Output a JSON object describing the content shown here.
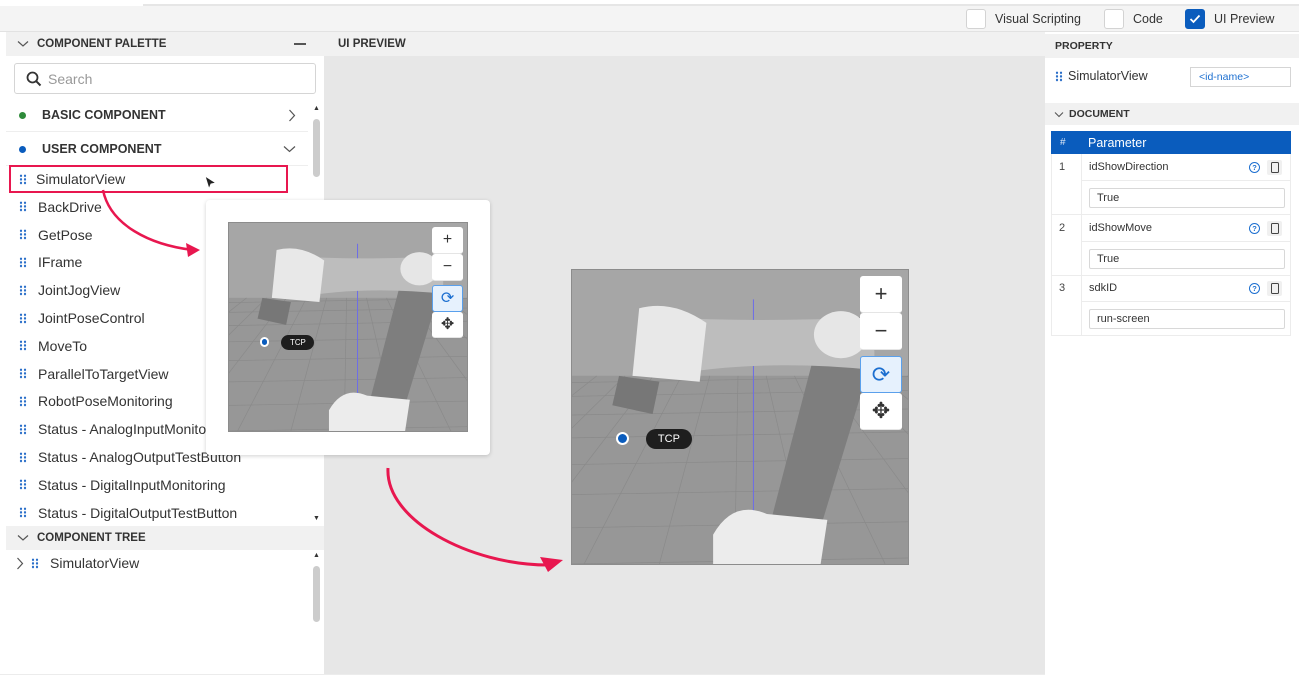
{
  "toolbar": {
    "modes": [
      {
        "label": "Visual Scripting",
        "checked": false
      },
      {
        "label": "Code",
        "checked": false
      },
      {
        "label": "UI Preview",
        "checked": true
      }
    ]
  },
  "palette": {
    "title": "COMPONENT PALETTE",
    "collapse_icon": "minus-icon",
    "search_placeholder": "Search",
    "categories": [
      {
        "label": "BASIC COMPONENT",
        "dot_color": "#2e8b3a",
        "state": "collapsed"
      },
      {
        "label": "USER COMPONENT",
        "dot_color": "#0a5cbd",
        "state": "expanded"
      }
    ],
    "items": [
      "SimulatorView",
      "BackDrive",
      "GetPose",
      "IFrame",
      "JointJogView",
      "JointPoseControl",
      "MoveTo",
      "ParallelToTargetView",
      "RobotPoseMonitoring",
      "Status - AnalogInputMonitoring",
      "Status - AnalogOutputTestButton",
      "Status - DigitalInputMonitoring",
      "Status - DigitalOutputTestButton"
    ],
    "selected_item": "SimulatorView"
  },
  "tree": {
    "title": "COMPONENT TREE",
    "nodes": [
      {
        "label": "SimulatorView",
        "expanded": false
      }
    ]
  },
  "preview": {
    "title": "UI PREVIEW",
    "simulator": {
      "tcp_label": "TCP",
      "controls": [
        "zoom-in",
        "zoom-out",
        "rotate",
        "pan"
      ],
      "active_control": "rotate"
    },
    "annotation_color": "#e8174f"
  },
  "property": {
    "title": "PROPERTY",
    "component_name": "SimulatorView",
    "id_placeholder": "<id-name>",
    "document_title": "DOCUMENT",
    "table_headers": [
      "#",
      "Parameter"
    ],
    "params": [
      {
        "index": "1",
        "name": "idShowDirection",
        "value": "True"
      },
      {
        "index": "2",
        "name": "idShowMove",
        "value": "True"
      },
      {
        "index": "3",
        "name": "sdkID",
        "value": "run-screen"
      }
    ]
  },
  "colors": {
    "accent": "#0a5cbd",
    "highlight": "#e8174f"
  }
}
